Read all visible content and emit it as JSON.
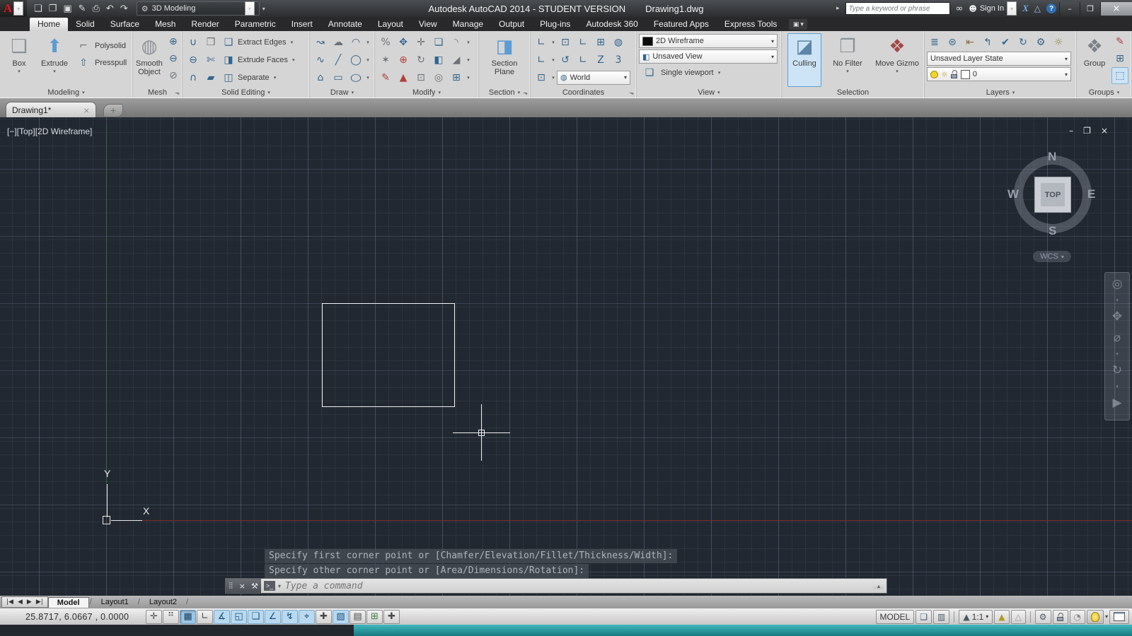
{
  "titlebar": {
    "app_title": "Autodesk AutoCAD 2014 - STUDENT VERSION",
    "doc_title": "Drawing1.dwg",
    "workspace": "3D Modeling",
    "search_placeholder": "Type a keyword or phrase",
    "sign_in_label": "Sign In"
  },
  "ribbon": {
    "tabs": [
      "Home",
      "Solid",
      "Surface",
      "Mesh",
      "Render",
      "Parametric",
      "Insert",
      "Annotate",
      "Layout",
      "View",
      "Manage",
      "Output",
      "Plug-ins",
      "Autodesk 360",
      "Featured Apps",
      "Express Tools"
    ],
    "panels": {
      "modeling": {
        "label": "Modeling",
        "box": "Box",
        "extrude": "Extrude",
        "polysolid": "Polysolid",
        "presspull": "Presspull"
      },
      "mesh": {
        "label": "Mesh",
        "smooth1": "Smooth",
        "smooth2": "Object"
      },
      "solid_editing": {
        "label": "Solid Editing",
        "extract_edges": "Extract Edges",
        "extrude_faces": "Extrude Faces",
        "separate": "Separate"
      },
      "draw": {
        "label": "Draw"
      },
      "modify": {
        "label": "Modify"
      },
      "section": {
        "label": "Section",
        "plane1": "Section",
        "plane2": "Plane"
      },
      "coordinates": {
        "label": "Coordinates",
        "world": "World"
      },
      "view": {
        "label": "View",
        "visual_style": "2D Wireframe",
        "named_view": "Unsaved View",
        "viewport": "Single viewport"
      },
      "selection": {
        "label": "Selection",
        "culling": "Culling",
        "no_filter": "No Filter",
        "move_gizmo": "Move Gizmo"
      },
      "layers": {
        "label": "Layers",
        "layer_state": "Unsaved Layer State",
        "current_layer": "0"
      },
      "groups": {
        "label": "Groups",
        "group": "Group"
      }
    }
  },
  "file_tabs": {
    "active_tab": "Drawing1*"
  },
  "viewport": {
    "label": "[−][Top][2D Wireframe]",
    "viewcube": {
      "north": "N",
      "south": "S",
      "east": "E",
      "west": "W",
      "face": "TOP",
      "wcs": "WCS"
    }
  },
  "command": {
    "history_line1": "Specify first corner point or [Chamfer/Elevation/Fillet/Thickness/Width]:",
    "history_line2": "Specify other corner point or [Area/Dimensions/Rotation]:",
    "placeholder": "Type a command"
  },
  "layout_tabs": {
    "model": "Model",
    "layout1": "Layout1",
    "layout2": "Layout2"
  },
  "statusbar": {
    "coordinates": "25.8717, 6.0667 , 0.0000",
    "model_label": "MODEL",
    "annotation_scale": "1:1"
  },
  "colors": {
    "canvas_bg": "#212831",
    "grid_major": "#3c4557",
    "axis_x_red": "#7d2a28",
    "axis_y_green": "#2e6f35",
    "accent_blue": "#3a87c8",
    "toggle_on": "#b8d9f0",
    "teal_strip": "#177a80"
  },
  "icons": {
    "logo_a": "A",
    "dropdown": "▾",
    "flyout": "▾",
    "launcher": "⬎",
    "new_file": "❏",
    "open_file": "❐",
    "save": "▣",
    "save_as": "✎",
    "plot": "⎙",
    "undo": "↶",
    "redo": "↷",
    "gear": "⚙",
    "infocenter_expand": "▸",
    "binoculars": "∞",
    "person": "☻",
    "exchange_x": "X",
    "a360": "△",
    "help": "?",
    "minimize": "–",
    "restore": "❐",
    "close": "×",
    "box": "❑",
    "extrude": "⬆",
    "polysolid": "⌐",
    "presspull": "⇧",
    "smooth_object": "◍",
    "mesh_plus": "⊕",
    "mesh_minus": "⊖",
    "mesh_none": "⊘",
    "union": "∪",
    "subtract": "⊖",
    "intersect": "∩",
    "interfere": "❒",
    "slice": "✄",
    "thicken": "▰",
    "extract_edges": "❑",
    "extrude_faces": "◨",
    "separate": "◫",
    "polyline": "↝",
    "revcloud": "☁",
    "arc": "◠",
    "spline": "∿",
    "line": "╱",
    "circle": "◯",
    "polygon": "⌂",
    "rectangle": "▭",
    "ellipse": "○",
    "trim": "%",
    "move3d": "✥",
    "move": "✛",
    "copy": "❏",
    "fillet": "◝",
    "explode": "✶",
    "rotate3d": "⊕",
    "rotate": "↻",
    "mirror": "◧",
    "chamfer": "◢",
    "erase": "✎",
    "scale": "▲",
    "stretch": "⊡",
    "offset": "◎",
    "array": "⊞",
    "section_plane": "◨",
    "ucs": "∟",
    "ucs_view": "⊡",
    "ucs_face": "∟",
    "ucs_object": "⊞",
    "ucs_world_mini": "◍",
    "ucs_x": "∟",
    "ucs_previous": "↺",
    "ucs_origin": "∟",
    "ucs_z": "Z",
    "ucs_3point": "3",
    "ucs_named": "⊡",
    "world_globe": "◍",
    "vs_swatch": "■",
    "named_view": "◧",
    "viewport_single": "❑",
    "culling": "◪",
    "no_filter": "❒",
    "move_gizmo": "❖",
    "layer_make_current": "≣",
    "layer_match": "⊜",
    "layer_previous": "⇤",
    "layer_states": "↰",
    "layer_isolate": "✔",
    "layer_unisolate": "↻",
    "layer_settings": "⚙",
    "layer_off": "☼",
    "layer_sun": "☼",
    "group": "❖",
    "group_edit": "✎",
    "group_add": "⊞",
    "group_select": "⬚",
    "vp_min": "–",
    "vp_restore": "❐",
    "vp_close": "×",
    "nav_wheel": "◎",
    "nav_pan": "✥",
    "nav_zoom": "⌀",
    "nav_orbit": "↻",
    "nav_motion": "▶",
    "grip": "⣿",
    "cmd_close": "×",
    "wrench": "⚒",
    "cmd_chip": ">_",
    "cmd_scroll": "▴",
    "tab_first": "|◀",
    "tab_prev": "◀",
    "tab_next": "▶",
    "tab_last": "▶|",
    "file_tab_close": "×",
    "file_tab_new": "+",
    "tgl_infer": "✛",
    "tgl_snap": "⠛",
    "tgl_grid": "▦",
    "tgl_ortho": "∟",
    "tgl_polar": "∡",
    "tgl_osnap": "◱",
    "tgl_3dosnap": "❑",
    "tgl_otrack": "∠",
    "tgl_ducs": "↯",
    "tgl_dyn": "⌖",
    "tgl_lwt": "✚",
    "tgl_tpy": "▨",
    "tgl_qp": "▤",
    "tgl_sc": "⊞",
    "tgl_am": "✚",
    "st_layout": "❏",
    "st_qvlayouts": "▥",
    "st_annoscale_tri": "▲",
    "st_annovis": "▲",
    "st_autoscale": "△",
    "st_perf": "◔"
  }
}
